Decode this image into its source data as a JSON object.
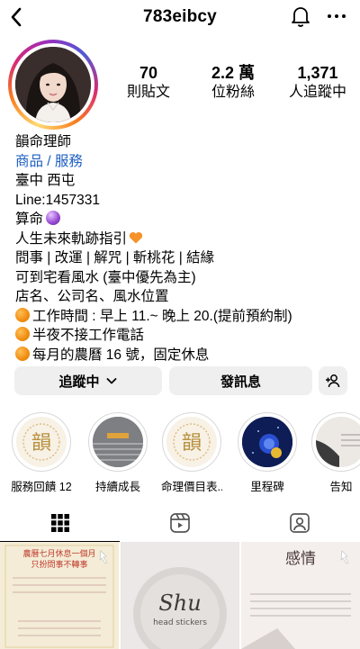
{
  "header": {
    "username": "783eibcy",
    "back_icon": "back-chevron-icon",
    "bell_icon": "bell-icon",
    "more_icon": "more-dots-icon"
  },
  "stats": [
    {
      "value": "70",
      "label": "則貼文"
    },
    {
      "value": "2.2 萬",
      "label": "位粉絲"
    },
    {
      "value": "1,371",
      "label": "人追蹤中"
    }
  ],
  "bio": {
    "name": "韻命理師",
    "category_link": "商品 / 服務",
    "lines": [
      "臺中 西屯",
      "Line:1457331",
      "算命",
      "人生未來軌跡指引",
      "問事 | 改運 | 解咒 | 斬桃花 | 結緣",
      "可到宅看風水 (臺中優先為主)",
      "店名、公司名、風水位置",
      "工作時間 : 早上 11.~ 晚上 20.(提前預約制)",
      "半夜不接工作電話",
      "每月的農曆 16 號，固定休息"
    ]
  },
  "buttons": {
    "follow": "追蹤中",
    "message": "發訊息"
  },
  "highlights": [
    {
      "label": "服務回饋 12"
    },
    {
      "label": "持續成長"
    },
    {
      "label": "命理價目表..."
    },
    {
      "label": "里程碑"
    },
    {
      "label": "告知"
    }
  ],
  "highlight_texts": {
    "yun": "韻"
  },
  "posts": {
    "p1_title": "農曆七月休息一個月",
    "p1_sub": "只扮問事不轉事",
    "p2_brand": "Shu",
    "p2_sub": "head stickers",
    "p3_title": "感情"
  }
}
